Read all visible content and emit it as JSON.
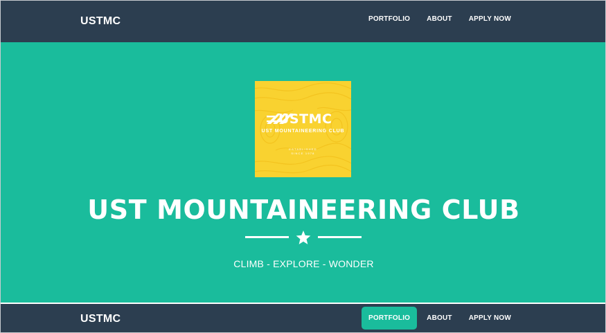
{
  "top_nav": {
    "brand": "USTMC",
    "items": [
      {
        "label": "PORTFOLIO",
        "active": false
      },
      {
        "label": "ABOUT",
        "active": false
      },
      {
        "label": "APPLY NOW",
        "active": false
      }
    ]
  },
  "hero": {
    "logo": {
      "title": "USTMC",
      "subtitle": "UST MOUNTAINEERING CLUB",
      "tiny_line_1": "ESTABLISHED",
      "tiny_line_2": "SINCE 1978"
    },
    "title": "UST MOUNTAINEERING CLUB",
    "divider_icon": "star-icon",
    "tagline": "CLIMB - EXPLORE - WONDER"
  },
  "sticky_nav": {
    "brand": "USTMC",
    "items": [
      {
        "label": "PORTFOLIO",
        "active": true
      },
      {
        "label": "ABOUT",
        "active": false
      },
      {
        "label": "APPLY NOW",
        "active": false
      }
    ]
  },
  "colors": {
    "nav_bg": "#2c3e50",
    "accent": "#1abc9c",
    "logo_bg": "#f9d230",
    "text": "#ffffff"
  }
}
